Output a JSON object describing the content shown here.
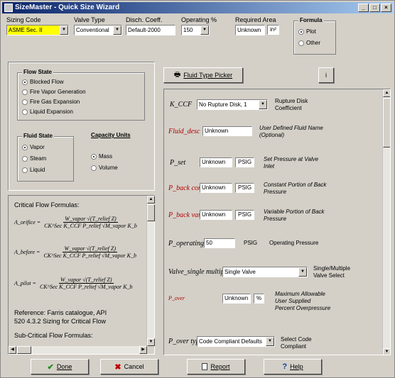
{
  "window": {
    "title": "SizeMaster - Quick Size Wizard"
  },
  "header": {
    "sizing_code_label": "Sizing Code",
    "sizing_code_value": "ASME Sec. II",
    "valve_type_label": "Valve Type",
    "valve_type_value": "Conventional",
    "disch_coeff_label": "Disch. Coeff.",
    "disch_coeff_value": "Default-2000",
    "operating_label": "Operating %",
    "operating_value": "150",
    "required_area_label": "Required Area",
    "required_area_value": "Unknown",
    "required_area_unit": "in²",
    "formula_group": "Formula",
    "formula_options": [
      {
        "label": "Plot",
        "selected": true
      },
      {
        "label": "Other",
        "selected": false
      }
    ]
  },
  "flow_state": {
    "title": "Flow State",
    "options": [
      {
        "label": "Blocked Flow",
        "selected": true
      },
      {
        "label": "Fire Vapor Generation",
        "selected": false
      },
      {
        "label": "Fire Gas Expansion",
        "selected": false
      },
      {
        "label": "Liquid Expansion",
        "selected": false
      }
    ]
  },
  "fluid_state": {
    "title": "Fluid State",
    "options": [
      {
        "label": "Vapor",
        "selected": true
      },
      {
        "label": "Steam",
        "selected": false
      },
      {
        "label": "Liquid",
        "selected": false
      }
    ]
  },
  "capacity_units": {
    "title": "Capacity Units",
    "options": [
      {
        "label": "Mass",
        "selected": true
      },
      {
        "label": "Volume",
        "selected": false
      }
    ]
  },
  "formula_panel": {
    "heading": "Critical Flow Formulas:",
    "eq1_lhs": "A_orifice =",
    "eq1_num": "W_vapor √(T_relief Z)",
    "eq1_den": "CK^Sec K_CCF P_relief √M_vapor K_b",
    "eq2_lhs": "A_before =",
    "eq2_num": "W_vapor √(T_relief Z)",
    "eq2_den": "CK^Sec K_CCF P_relief √M_vapor K_b",
    "eq3_lhs": "A_pilot =",
    "eq3_num": "W_vapor √(T_relief Z)",
    "eq3_den": "CK^Sec K_CCF P_relief √M_vapor K_b",
    "reference_line1": "Reference: Farris catalogue, API",
    "reference_line2": "520 4.3.2 Sizing for Critical Flow",
    "subcritical": "Sub-Critical Flow Formulas:"
  },
  "fluid_picker_button": "Fluid Type Picker",
  "info_button": "i",
  "params": [
    {
      "symbol": "K_CCF",
      "value": "No Rupture Disk, 1",
      "desc": "Rupture Disk Coefficient"
    },
    {
      "symbol": "Fluid_desc",
      "value": "Unknown",
      "desc": "User Defined Fluid Name (Optional)"
    },
    {
      "symbol": "P_set",
      "value": "Unknown",
      "unit": "PSIG",
      "desc": "Set Pressure at Valve Inlet"
    },
    {
      "symbol": "P_back const",
      "value": "Unknown",
      "unit": "PSIG",
      "desc": "Constant Portion of Back Pressure"
    },
    {
      "symbol": "P_back var",
      "value": "Unknown",
      "unit": "PSIG",
      "desc": "Variable Portion of Back Pressure"
    },
    {
      "symbol": "P_operating",
      "value": "50",
      "unit": "PSIG",
      "desc": "Operating Pressure"
    },
    {
      "symbol": "Valve_single multiple",
      "value": "Single Valve",
      "desc": "Single/Multiple Valve Select"
    },
    {
      "symbol": "P_over",
      "value": "Unknown",
      "unit": "%",
      "desc": "Maximum Allowable User Supplied Percent Overpressure"
    },
    {
      "symbol": "P_over type",
      "value": "Code Compliant Defaults",
      "desc": "Select Code Compliant"
    }
  ],
  "footer": {
    "done": "Done",
    "cancel": "Cancel",
    "report": "Report",
    "help": "Help"
  }
}
